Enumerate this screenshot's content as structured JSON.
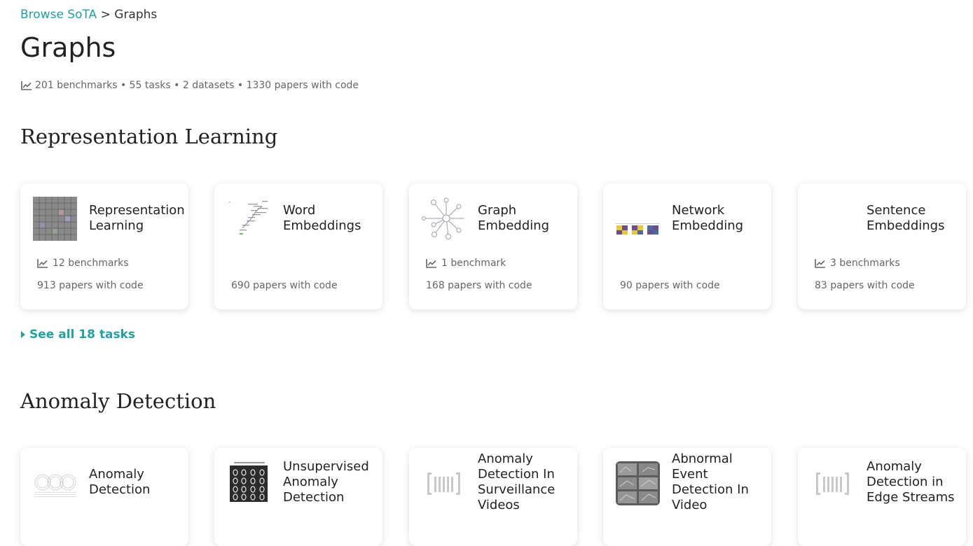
{
  "breadcrumb": {
    "root": "Browse SoTA",
    "separator": ">",
    "current": "Graphs"
  },
  "page": {
    "title": "Graphs",
    "stats": "201 benchmarks • 55 tasks • 2 datasets • 1330 papers with code"
  },
  "sections": [
    {
      "title": "Representation Learning",
      "see_all": "See all 18 tasks",
      "cards": [
        {
          "name": "Representation Learning",
          "benchmarks": "12 benchmarks",
          "papers": "913 papers with code",
          "thumb": "grid-image"
        },
        {
          "name": "Word Embeddings",
          "benchmarks": "",
          "papers": "690 papers with code",
          "thumb": "scatter-text-image"
        },
        {
          "name": "Graph Embedding",
          "benchmarks": "1 benchmark",
          "papers": "168 papers with code",
          "thumb": "network-graph-image"
        },
        {
          "name": "Network Embedding",
          "benchmarks": "",
          "papers": "90 papers with code",
          "thumb": "colored-squares-image"
        },
        {
          "name": "Sentence Embeddings",
          "benchmarks": "3 benchmarks",
          "papers": "83 papers with code",
          "thumb": ""
        }
      ]
    },
    {
      "title": "Anomaly Detection",
      "cards": [
        {
          "name": "Anomaly Detection",
          "thumb": "circles-image"
        },
        {
          "name": "Unsupervised Anomaly Detection",
          "thumb": "digits-grid-image"
        },
        {
          "name": "Anomaly Detection In Surveillance Videos",
          "thumb": "placeholder-bars-icon"
        },
        {
          "name": "Abnormal Event Detection In Video",
          "thumb": "video-frames-image"
        },
        {
          "name": "Anomaly Detection in Edge Streams",
          "thumb": "placeholder-bars-icon"
        }
      ]
    }
  ],
  "colors": {
    "accent": "#21a1a0",
    "text": "#222222",
    "muted": "#666666"
  }
}
